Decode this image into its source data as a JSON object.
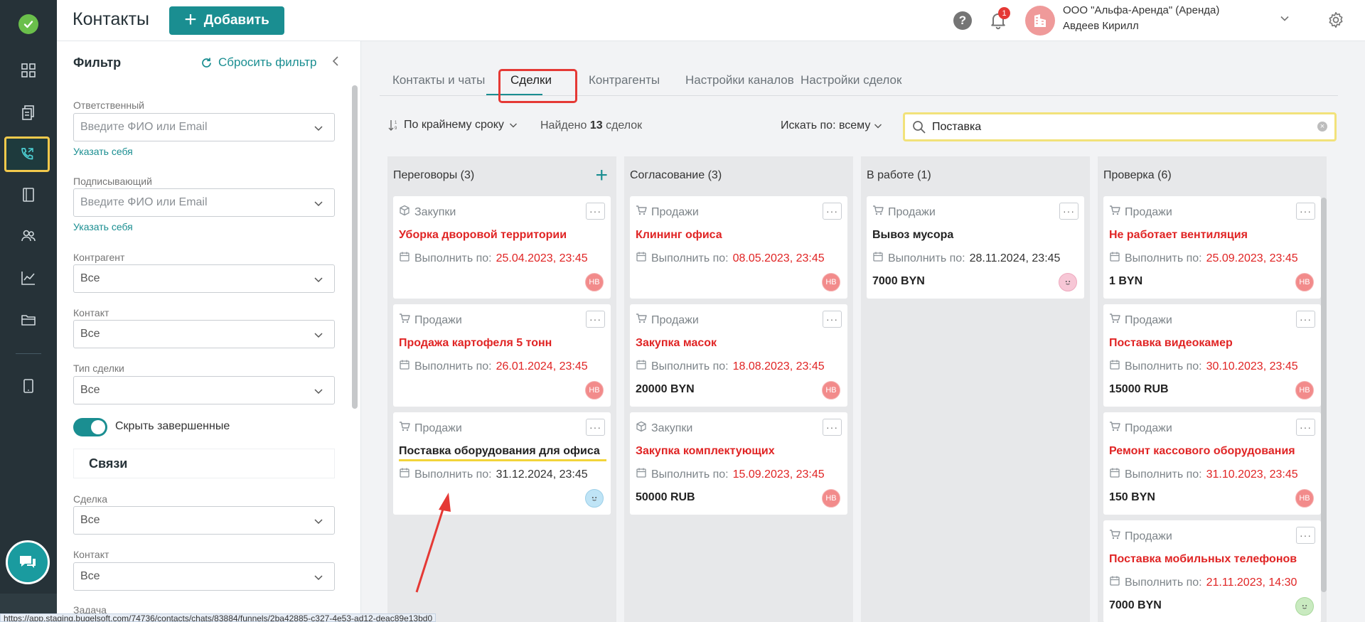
{
  "header": {
    "title": "Контакты",
    "add_label": "Добавить",
    "notifications_count": "1",
    "org_name": "ООО \"Альфа-Аренда\" (Аренда)",
    "user_name": "Авдеев Кирилл"
  },
  "filter": {
    "title": "Фильтр",
    "reset_label": "Сбросить фильтр",
    "responsible_label": "Ответственный",
    "responsible_placeholder": "Введите ФИО или Email",
    "assign_self_1": "Указать себя",
    "signer_label": "Подписывающий",
    "signer_placeholder": "Введите ФИО или Email",
    "assign_self_2": "Указать себя",
    "counterparty_label": "Контрагент",
    "counterparty_value": "Все",
    "contact_label": "Контакт",
    "contact_value": "Все",
    "deal_type_label": "Тип сделки",
    "deal_type_value": "Все",
    "hide_completed_label": "Скрыть завершенные",
    "hide_completed": true,
    "links_title": "Связи",
    "deal_label": "Сделка",
    "deal_value": "Все",
    "contact2_label": "Контакт",
    "contact2_value": "Все",
    "task_label": "Задача"
  },
  "tabs": [
    "Контакты и чаты",
    "Сделки",
    "Контрагенты",
    "Настройки каналов",
    "Настройки сделок"
  ],
  "active_tab": "Сделки",
  "toolbar": {
    "sort_label": "По крайнему сроку",
    "found_prefix": "Найдено",
    "found_count": "13",
    "found_suffix": "сделок",
    "search_by_label": "Искать по: всему",
    "search_value": "Поставка"
  },
  "due_prefix": "Выполнить по:",
  "columns": [
    {
      "title": "Переговоры (3)",
      "cards": [
        {
          "type": "Закупки",
          "title": "Уборка дворовой территории",
          "due": "25.04.2023, 23:45",
          "overdue": true,
          "amount": "",
          "avatar": "НВ"
        },
        {
          "type": "Продажи",
          "title": "Продажа картофеля 5 тонн",
          "due": "26.01.2024, 23:45",
          "overdue": true,
          "amount": "",
          "avatar": "НВ"
        },
        {
          "type": "Продажи",
          "title": "Поставка оборудования для офиса",
          "due": "31.12.2024, 23:45",
          "overdue": false,
          "amount": "",
          "avatar": ""
        }
      ]
    },
    {
      "title": "Согласование (3)",
      "cards": [
        {
          "type": "Продажи",
          "title": "Клининг офиса",
          "due": "08.05.2023, 23:45",
          "overdue": true,
          "amount": "",
          "avatar": "НВ"
        },
        {
          "type": "Продажи",
          "title": "Закупка масок",
          "due": "18.08.2023, 23:45",
          "overdue": true,
          "amount": "20000 BYN",
          "avatar": "НВ"
        },
        {
          "type": "Закупки",
          "title": "Закупка комплектующих",
          "due": "15.09.2023, 23:45",
          "overdue": true,
          "amount": "50000 RUB",
          "avatar": "НВ"
        }
      ]
    },
    {
      "title": "В работе (1)",
      "cards": [
        {
          "type": "Продажи",
          "title": "Вывоз мусора",
          "due": "28.11.2024, 23:45",
          "overdue": false,
          "amount": "7000 BYN",
          "avatar": ""
        }
      ]
    },
    {
      "title": "Проверка (6)",
      "cards": [
        {
          "type": "Продажи",
          "title": "Не работает вентиляция",
          "due": "25.09.2023, 23:45",
          "overdue": true,
          "amount": "1 BYN",
          "avatar": "НВ"
        },
        {
          "type": "Продажи",
          "title": "Поставка видеокамер",
          "due": "30.10.2023, 23:45",
          "overdue": true,
          "amount": "15000 RUB",
          "avatar": "НВ"
        },
        {
          "type": "Продажи",
          "title": "Ремонт кассового оборудования",
          "due": "31.10.2023, 23:45",
          "overdue": true,
          "amount": "150 BYN",
          "avatar": "НВ"
        },
        {
          "type": "Продажи",
          "title": "Поставка мобильных телефонов",
          "due": "21.11.2023, 14:30",
          "overdue": true,
          "amount": "7000 BYN",
          "avatar": ""
        }
      ]
    }
  ],
  "status_url": "https://app.staging.bugelsoft.com/74736/contacts/chats/83884/funnels/2ba42885-c327-4e53-ad12-deac89e13bd0",
  "colors": {
    "accent": "#1a8e91",
    "overdue": "#e02424",
    "rail": "#263238",
    "highlight_red": "#e53935",
    "highlight_yellow": "#f2d43a"
  }
}
